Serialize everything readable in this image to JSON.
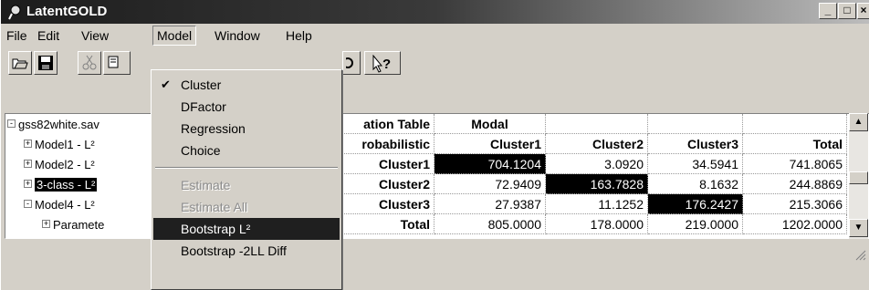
{
  "window": {
    "title": "LatentGOLD"
  },
  "title_buttons": {
    "minimize": "_",
    "maximize": "□",
    "close": "×"
  },
  "menubar": {
    "items": [
      "File",
      "Edit",
      "View",
      "Model",
      "Window",
      "Help"
    ]
  },
  "toolbar": {
    "icons": [
      "open-icon",
      "save-icon",
      "cut-icon",
      "copy-icon",
      "context-help-icon"
    ],
    "help_label": "?"
  },
  "tree": {
    "root": "gss82white.sav",
    "items": [
      {
        "label": "Model1 - L²",
        "expander": "+"
      },
      {
        "label": "Model2 - L²",
        "expander": "+"
      },
      {
        "label": "3-class - L²",
        "expander": "+"
      },
      {
        "label": "Model4 - L²",
        "expander": "-"
      },
      {
        "label": "Paramete",
        "expander": "+"
      }
    ],
    "root_expander": "-"
  },
  "table": {
    "header_left": "ation Table",
    "header_modal": "Modal",
    "subheader_left": "robabilistic",
    "columns": [
      "Cluster1",
      "Cluster2",
      "Cluster3",
      "Total"
    ],
    "rows": [
      {
        "label": "Cluster1",
        "values": [
          "704.1204",
          "3.0920",
          "34.5941",
          "741.8065"
        ]
      },
      {
        "label": "Cluster2",
        "values": [
          "72.9409",
          "163.7828",
          "8.1632",
          "244.8869"
        ]
      },
      {
        "label": "Cluster3",
        "values": [
          "27.9387",
          "11.1252",
          "176.2427",
          "215.3066"
        ]
      },
      {
        "label": "Total",
        "values": [
          "805.0000",
          "178.0000",
          "219.0000",
          "1202.0000"
        ]
      }
    ]
  },
  "model_menu": {
    "items": [
      {
        "label": "Cluster",
        "checked": true,
        "disabled": false
      },
      {
        "label": "DFactor",
        "checked": false,
        "disabled": false
      },
      {
        "label": "Regression",
        "checked": false,
        "disabled": false
      },
      {
        "label": "Choice",
        "checked": false,
        "disabled": false
      },
      {
        "label": "Estimate",
        "checked": false,
        "disabled": true
      },
      {
        "label": "Estimate All",
        "checked": false,
        "disabled": true
      },
      {
        "label": "Bootstrap L²",
        "checked": false,
        "disabled": false,
        "selected": true
      },
      {
        "label": "Bootstrap -2LL Diff",
        "checked": false,
        "disabled": false
      }
    ],
    "check_glyph": "✔"
  },
  "colors": {
    "menu_selected": "#1f1f1f",
    "face": "#d4d0c8"
  }
}
